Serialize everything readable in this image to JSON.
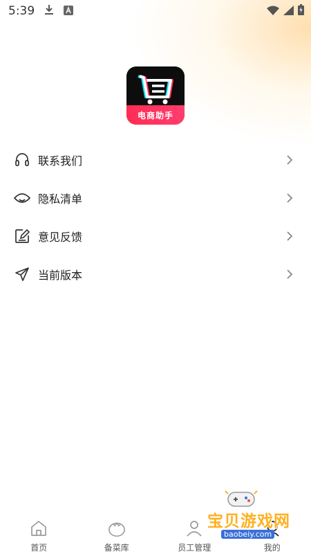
{
  "status_bar": {
    "time": "5:39",
    "left_icons": [
      "download-icon",
      "font-icon"
    ],
    "right_icons": [
      "wifi-icon",
      "signal-icon",
      "battery-icon"
    ]
  },
  "logo": {
    "text": "电商助手",
    "colors": {
      "background": "#0d0d0d",
      "band": "#ff2d55",
      "accent_cyan": "#00e5ff",
      "accent_pink": "#ff2d55"
    }
  },
  "menu": {
    "items": [
      {
        "label": "联系我们",
        "icon": "headset-icon"
      },
      {
        "label": "隐私清单",
        "icon": "eye-icon"
      },
      {
        "label": "意见反馈",
        "icon": "edit-icon"
      },
      {
        "label": "当前版本",
        "icon": "send-icon"
      }
    ]
  },
  "bottom_nav": {
    "items": [
      {
        "label": "首页",
        "icon": "home-icon"
      },
      {
        "label": "备菜库",
        "icon": "tomato-icon"
      },
      {
        "label": "员工管理",
        "icon": "staff-icon"
      },
      {
        "label": "我的",
        "icon": "profile-icon"
      }
    ]
  },
  "watermark": {
    "title": "宝贝游戏网",
    "url": "baobeiy.com"
  }
}
